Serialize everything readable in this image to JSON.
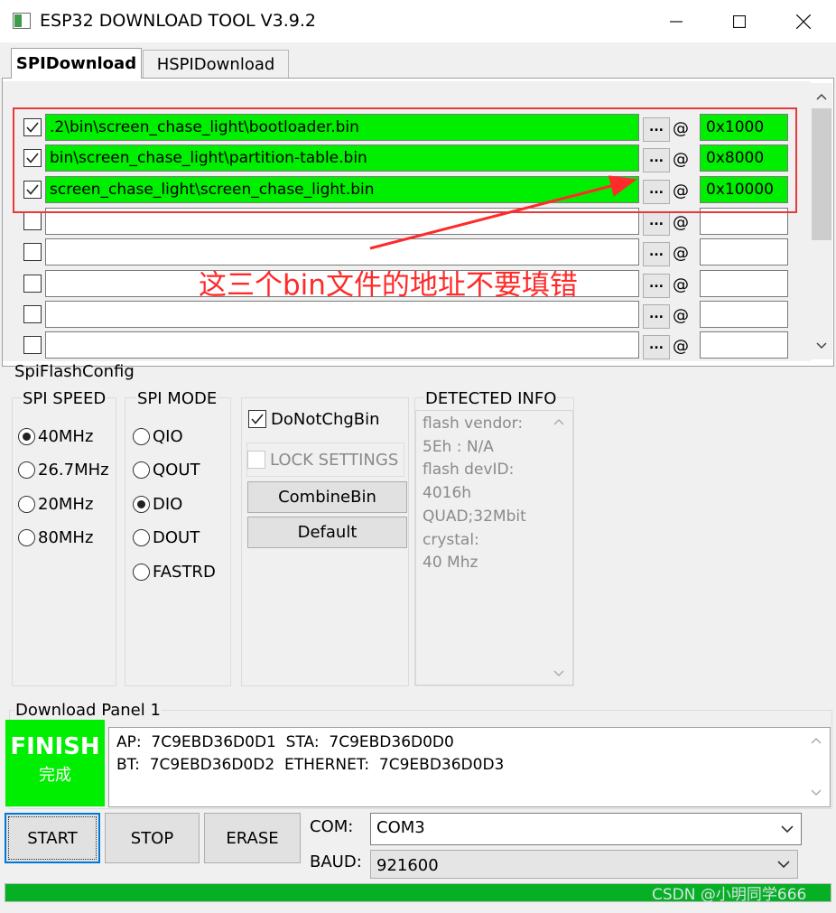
{
  "window": {
    "title": "ESP32 DOWNLOAD TOOL V3.9.2"
  },
  "tabs": [
    {
      "label": "SPIDownload",
      "active": true
    },
    {
      "label": "HSPIDownload",
      "active": false
    }
  ],
  "files": [
    {
      "checked": true,
      "path": ".2\\bin\\screen_chase_light\\bootloader.bin",
      "browse": "...",
      "at": "@",
      "address": "0x1000",
      "highlight": true
    },
    {
      "checked": true,
      "path": "bin\\screen_chase_light\\partition-table.bin",
      "browse": "...",
      "at": "@",
      "address": "0x8000",
      "highlight": true
    },
    {
      "checked": true,
      "path": "screen_chase_light\\screen_chase_light.bin",
      "browse": "...",
      "at": "@",
      "address": "0x10000",
      "highlight": true
    },
    {
      "checked": false,
      "path": "",
      "browse": "...",
      "at": "@",
      "address": "",
      "highlight": false
    },
    {
      "checked": false,
      "path": "",
      "browse": "...",
      "at": "@",
      "address": "",
      "highlight": false
    },
    {
      "checked": false,
      "path": "",
      "browse": "...",
      "at": "@",
      "address": "",
      "highlight": false
    },
    {
      "checked": false,
      "path": "",
      "browse": "...",
      "at": "@",
      "address": "",
      "highlight": false
    },
    {
      "checked": false,
      "path": "",
      "browse": "...",
      "at": "@",
      "address": "",
      "highlight": false
    }
  ],
  "annotation": {
    "text": "这三个bin文件的地址不要填错",
    "color": "#ff2a2a"
  },
  "spi_flash_config": {
    "label": "SpiFlashConfig",
    "speed": {
      "label": "SPI SPEED",
      "options": [
        "40MHz",
        "26.7MHz",
        "20MHz",
        "80MHz"
      ],
      "selected": "40MHz"
    },
    "mode": {
      "label": "SPI MODE",
      "options": [
        "QIO",
        "QOUT",
        "DIO",
        "DOUT",
        "FASTRD"
      ],
      "selected": "DIO"
    },
    "donot_chg_bin": {
      "label": "DoNotChgBin",
      "checked": true
    },
    "lock_settings": {
      "label": "LOCK SETTINGS",
      "checked": false
    },
    "combine_label": "CombineBin",
    "default_label": "Default",
    "detected_info": {
      "label": "DETECTED INFO",
      "lines": [
        "flash vendor:",
        "5Eh : N/A",
        "flash devID:",
        "4016h",
        "QUAD;32Mbit",
        "crystal:",
        "40 Mhz"
      ]
    }
  },
  "download_panel": {
    "label": "Download Panel 1",
    "status_en": "FINISH",
    "status_cn": "完成",
    "status_color": "#00ee00",
    "mac_lines": [
      "AP:  7C9EBD36D0D1  STA:  7C9EBD36D0D0",
      "BT:  7C9EBD36D0D2  ETHERNET:  7C9EBD36D0D3"
    ],
    "start_label": "START",
    "stop_label": "STOP",
    "erase_label": "ERASE",
    "com_label": "COM:",
    "com_value": "COM3",
    "baud_label": "BAUD:",
    "baud_value": "921600",
    "progress": 1.0,
    "progress_color": "#06b025"
  },
  "watermark": "CSDN @小明同学666"
}
